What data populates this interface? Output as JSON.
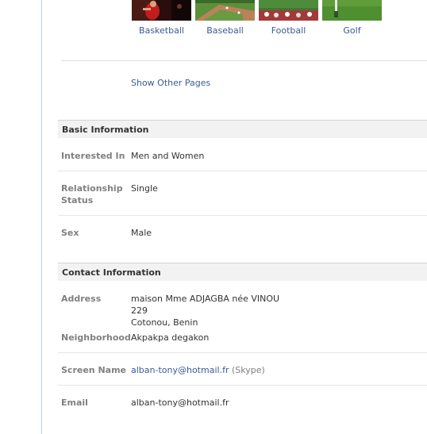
{
  "pages": {
    "items": [
      {
        "label": "Basketball"
      },
      {
        "label": "Baseball"
      },
      {
        "label": "Football"
      },
      {
        "label": "Golf"
      }
    ],
    "show_other_label": "Show Other Pages"
  },
  "basic_info": {
    "title": "Basic Information",
    "interested_in": {
      "label": "Interested In",
      "value": "Men and Women"
    },
    "relationship": {
      "label_line1": "Relationship",
      "label_line2": "Status",
      "value": "Single"
    },
    "sex": {
      "label": "Sex",
      "value": "Male"
    }
  },
  "contact_info": {
    "title": "Contact Information",
    "address": {
      "label": "Address",
      "line1": "maison Mme ADJAGBA née VINOU",
      "line2": "229",
      "line3": "Cotonou, Benin"
    },
    "neighborhood": {
      "label": "Neighborhood",
      "value": "Akpakpa degakon"
    },
    "screen_name": {
      "label": "Screen Name",
      "value": "alban-tony@hotmail.fr",
      "service": "(Skype)"
    },
    "email": {
      "label": "Email",
      "value": "alban-tony@hotmail.fr"
    }
  },
  "colors": {
    "link": "#3b5998",
    "label": "#808080",
    "section_bg": "#f2f2f2"
  }
}
